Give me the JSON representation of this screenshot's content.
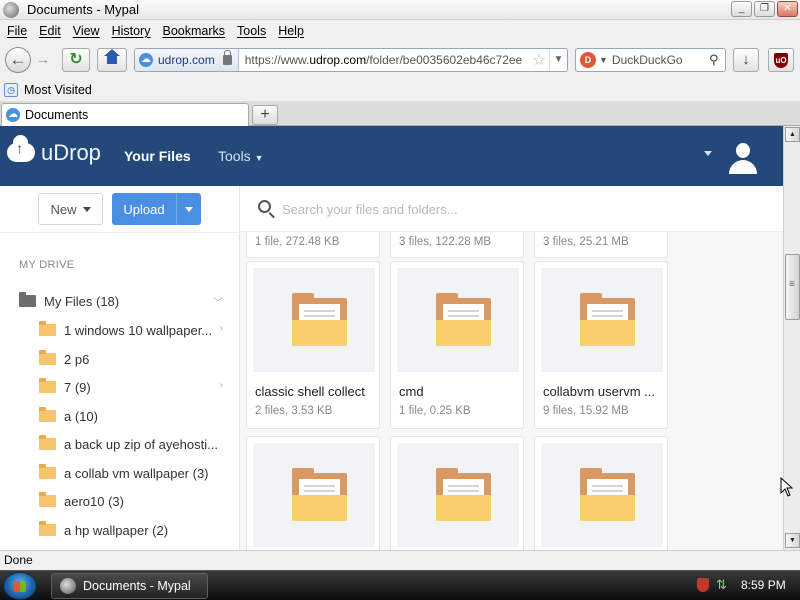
{
  "window": {
    "title": "Documents - Mypal",
    "buttons": [
      "_",
      "❐",
      "✕"
    ]
  },
  "menu": [
    "File",
    "Edit",
    "View",
    "History",
    "Bookmarks",
    "Tools",
    "Help"
  ],
  "navbar": {
    "identity_domain": "udrop.com",
    "url_prefix": "https://www.",
    "url_host": "udrop.com",
    "url_rest": "/folder/be0035602eb46c72ee",
    "search_placeholder": "DuckDuckGo",
    "icons": [
      "back-icon",
      "forward-icon",
      "reload-icon",
      "home-icon",
      "lock-icon",
      "star-icon",
      "download-icon",
      "ublock-icon"
    ]
  },
  "bookmarks": {
    "most_visited": "Most Visited"
  },
  "tabs": [
    {
      "label": "Documents"
    }
  ],
  "app": {
    "logo_text": "uDrop",
    "nav_files": "Your Files",
    "nav_tools": "Tools",
    "new_label": "New",
    "upload_label": "Upload",
    "search_placeholder": "Search your files and folders...",
    "accent_color": "#22497a",
    "button_color": "#4a90e2"
  },
  "sidebar": {
    "heading": "MY DRIVE",
    "root": "My Files (18)",
    "items": [
      {
        "label": "1 windows 10 wallpaper...",
        "has_children": true
      },
      {
        "label": "2 p6",
        "has_children": false
      },
      {
        "label": "7 (9)",
        "has_children": true
      },
      {
        "label": "a (10)",
        "has_children": false
      },
      {
        "label": "a back up zip of ayehosti...",
        "has_children": false
      },
      {
        "label": "a collab vm wallpaper (3)",
        "has_children": false
      },
      {
        "label": "aero10 (3)",
        "has_children": false
      },
      {
        "label": "a hp wallpaper (2)",
        "has_children": false
      }
    ]
  },
  "grid": {
    "top_partial": [
      {
        "meta": "1 file, 272.48 KB"
      },
      {
        "meta": "3 files, 122.28 MB"
      },
      {
        "meta": "3 files, 25.21 MB"
      }
    ],
    "row": [
      {
        "name": "classic shell collect",
        "meta": "2 files, 3.53 KB"
      },
      {
        "name": "cmd",
        "meta": "1 file, 0.25 KB"
      },
      {
        "name": "collabvm uservm ...",
        "meta": "9 files, 15.92 MB"
      }
    ]
  },
  "status": "Done",
  "taskbar": {
    "item": "Documents - Mypal",
    "clock": "8:59 PM"
  }
}
